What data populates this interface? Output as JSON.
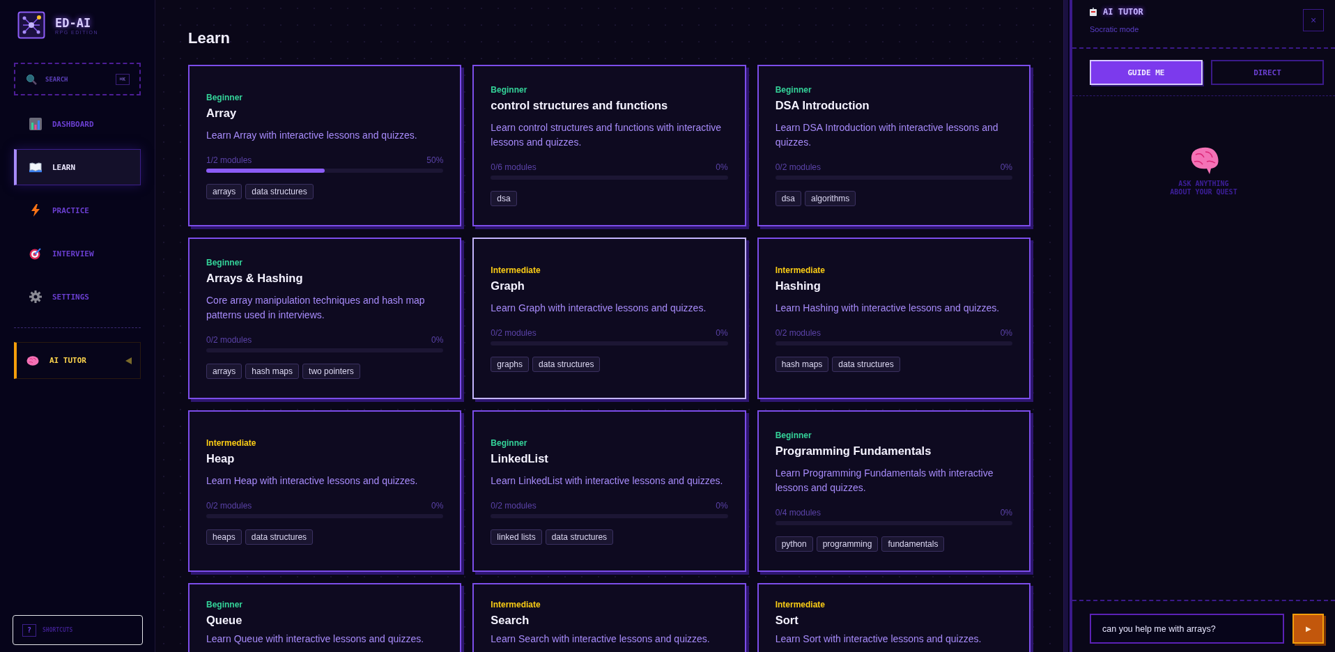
{
  "brand": {
    "name": "ED-AI",
    "subtitle": "RPG EDITION"
  },
  "search": {
    "label": "SEARCH",
    "shortcut": "⌘K"
  },
  "nav": [
    {
      "label": "DASHBOARD",
      "selected": false
    },
    {
      "label": "LEARN",
      "selected": true
    },
    {
      "label": "PRACTICE",
      "selected": false
    },
    {
      "label": "INTERVIEW",
      "selected": false
    },
    {
      "label": "SETTINGS",
      "selected": false
    }
  ],
  "tutor_toggle": {
    "label": "AI TUTOR"
  },
  "shortcuts": {
    "icon_text": "?",
    "label": "SHORTCUTS"
  },
  "page_title": "Learn",
  "courses": [
    {
      "difficulty": "Beginner",
      "kind": "beginner",
      "title": "Array",
      "description": "Learn Array with interactive lessons and quizzes.",
      "modules": "1/2 modules",
      "percent": "50%",
      "level": 0.5,
      "tags": [
        "arrays",
        "data structures"
      ],
      "hovered": false
    },
    {
      "difficulty": "Beginner",
      "kind": "beginner",
      "title": "control structures and functions",
      "description": "Learn control structures and functions with interactive lessons and quizzes.",
      "modules": "0/6 modules",
      "percent": "0%",
      "tags": [
        "dsa"
      ],
      "hovered": false
    },
    {
      "difficulty": "Beginner",
      "kind": "beginner",
      "title": "DSA Introduction",
      "description": "Learn DSA Introduction with interactive lessons and quizzes.",
      "modules": "0/2 modules",
      "percent": "0%",
      "tags": [
        "dsa",
        "algorithms"
      ],
      "hovered": false
    },
    {
      "difficulty": "Beginner",
      "kind": "beginner",
      "title": "Arrays & Hashing",
      "description": "Core array manipulation techniques and hash map patterns used in interviews.",
      "modules": "0/2 modules",
      "percent": "0%",
      "tags": [
        "arrays",
        "hash maps",
        "two pointers"
      ],
      "hovered": false
    },
    {
      "difficulty": "Intermediate",
      "kind": "intermediate",
      "title": "Graph",
      "description": "Learn Graph with interactive lessons and quizzes.",
      "modules": "0/2 modules",
      "percent": "0%",
      "tags": [
        "graphs",
        "data structures"
      ],
      "hovered": true
    },
    {
      "difficulty": "Intermediate",
      "kind": "intermediate",
      "title": "Hashing",
      "description": "Learn Hashing with interactive lessons and quizzes.",
      "modules": "0/2 modules",
      "percent": "0%",
      "tags": [
        "hash maps",
        "data structures"
      ],
      "hovered": false
    },
    {
      "difficulty": "Intermediate",
      "kind": "intermediate",
      "title": "Heap",
      "description": "Learn Heap with interactive lessons and quizzes.",
      "modules": "0/2 modules",
      "percent": "0%",
      "tags": [
        "heaps",
        "data structures"
      ],
      "hovered": false
    },
    {
      "difficulty": "Beginner",
      "kind": "beginner",
      "title": "LinkedList",
      "description": "Learn LinkedList with interactive lessons and quizzes.",
      "modules": "0/2 modules",
      "percent": "0%",
      "tags": [
        "linked lists",
        "data structures"
      ],
      "hovered": false
    },
    {
      "difficulty": "Beginner",
      "kind": "beginner",
      "title": "Programming Fundamentals",
      "description": "Learn Programming Fundamentals with interactive lessons and quizzes.",
      "modules": "0/4 modules",
      "percent": "0%",
      "tags": [
        "python",
        "programming",
        "fundamentals"
      ],
      "hovered": false
    },
    {
      "difficulty": "Beginner",
      "kind": "beginner",
      "title": "Queue",
      "description": "Learn Queue with interactive lessons and quizzes."
    },
    {
      "difficulty": "Intermediate",
      "kind": "intermediate",
      "title": "Search",
      "description": "Learn Search with interactive lessons and quizzes."
    },
    {
      "difficulty": "Intermediate",
      "kind": "intermediate",
      "title": "Sort",
      "description": "Learn Sort with interactive lessons and quizzes."
    }
  ],
  "tutor": {
    "title": "AI TUTOR",
    "mode": "Socratic mode",
    "close": "×",
    "modes": [
      {
        "label": "GUIDE ME",
        "selected": true
      },
      {
        "label": "DIRECT",
        "selected": false
      }
    ],
    "empty_text": "ASK ANYTHING\nABOUT YOUR QUEST",
    "input_value": "can you help me with arrays?",
    "send": "▶"
  }
}
